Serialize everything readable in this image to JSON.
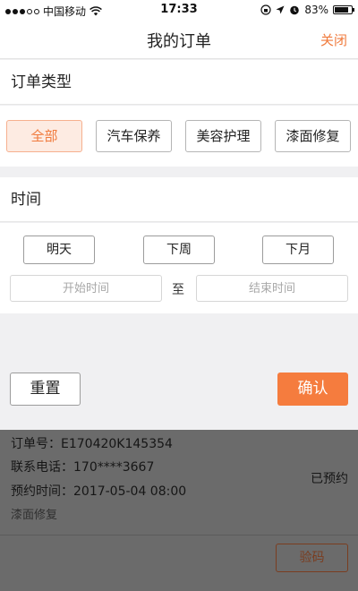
{
  "status_bar": {
    "carrier": "中国移动",
    "time": "17:33",
    "battery": "83%",
    "battery_level": 0.83
  },
  "nav": {
    "title": "我的订单",
    "close_label": "关闭"
  },
  "filter": {
    "type_section_title": "订单类型",
    "type_options": [
      "全部",
      "汽车保养",
      "美容护理",
      "漆面修复"
    ],
    "selected_type": "全部",
    "time_section_title": "时间",
    "time_options": [
      "明天",
      "下周",
      "下月"
    ],
    "start_placeholder": "开始时间",
    "range_separator": "至",
    "end_placeholder": "结束时间",
    "reset_label": "重置",
    "confirm_label": "确认"
  },
  "order": {
    "number_line": "订单号：E170420K145354",
    "phone_line": "联系电话：170****3667",
    "appointment_line": "预约时间：2017-05-04 08:00",
    "service": "漆面修复",
    "status": "已预约",
    "verify_label": "验码"
  },
  "colors": {
    "accent": "#f57c3e",
    "accent_text": "#f07a3c",
    "overlay": "#6b6b6b"
  },
  "icons": [
    "wifi-icon",
    "lock-rotation-icon",
    "location-arrow-icon",
    "alarm-icon",
    "battery-icon"
  ]
}
